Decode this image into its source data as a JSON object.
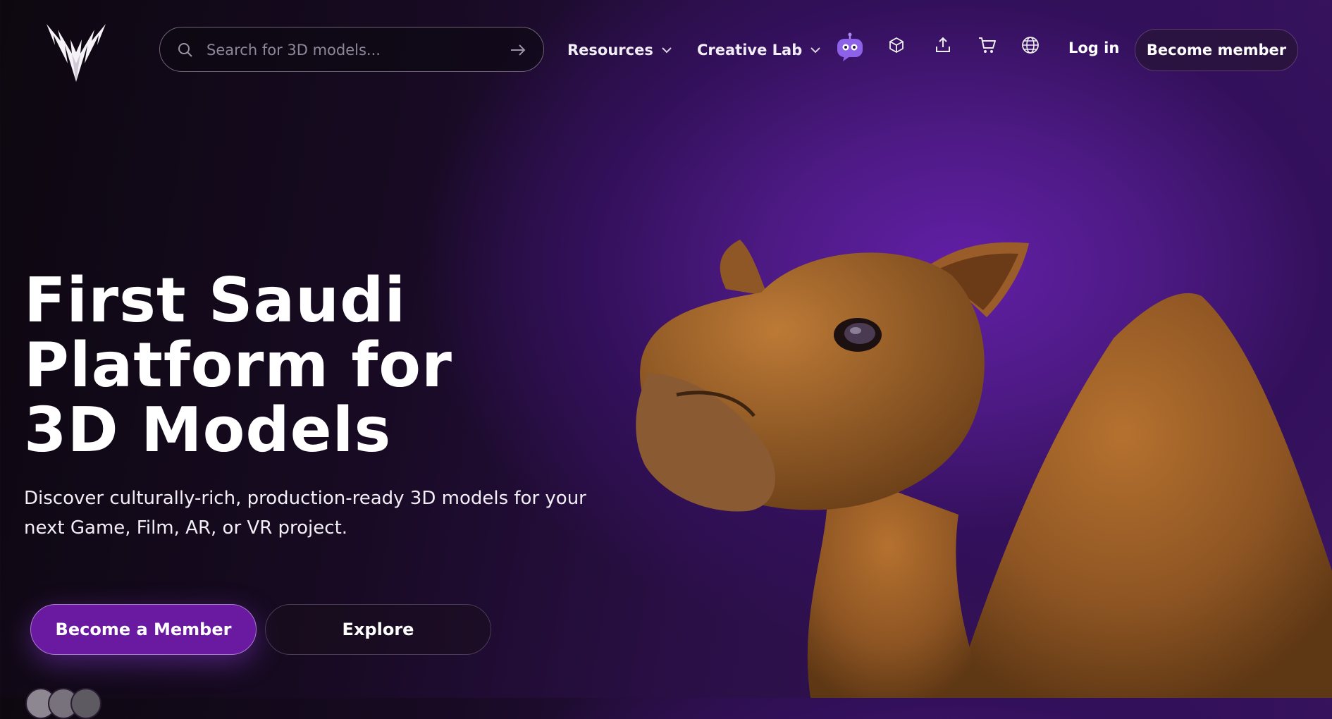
{
  "header": {
    "logo": "v-logo-icon",
    "search": {
      "placeholder": "Search for 3D models..."
    },
    "menus": [
      {
        "label": "Resources"
      },
      {
        "label": "Creative Lab"
      }
    ],
    "icons": [
      "ai-bot-icon",
      "cube-icon",
      "upload-icon",
      "cart-icon",
      "globe-icon"
    ],
    "login_label": "Log in",
    "member_label": "Become member"
  },
  "hero": {
    "title_lines": [
      "First Saudi",
      "Platform for",
      "3D Models"
    ],
    "subtitle": "Discover culturally-rich, production-ready 3D models for your next Game, Film, AR, or VR project.",
    "primary_cta": "Become a Member",
    "secondary_cta": "Explore"
  },
  "colors": {
    "accent": "#6a1aa0",
    "bot": "#8d62e8",
    "background_glow": "#621fa6"
  }
}
